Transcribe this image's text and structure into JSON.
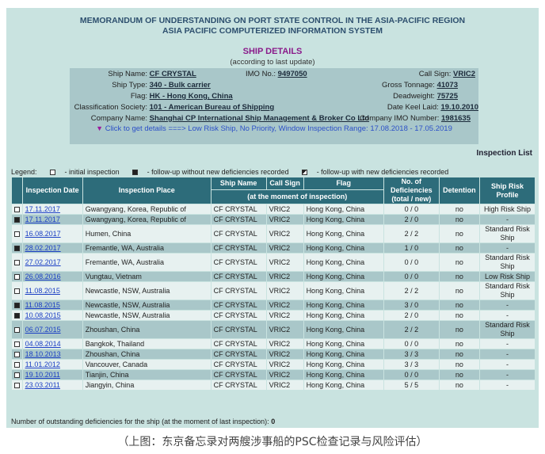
{
  "header": {
    "line1": "MEMORANDUM OF UNDERSTANDING ON PORT STATE CONTROL IN THE ASIA-PACIFIC REGION",
    "line2": "ASIA PACIFIC COMPUTERIZED INFORMATION SYSTEM"
  },
  "ship_details": {
    "title": "SHIP DETAILS",
    "subtitle": "(according to last update)",
    "ship_name_label": "Ship Name:",
    "ship_name": "CF CRYSTAL",
    "imo_label": "IMO No.:",
    "imo": "9497050",
    "call_sign_label": "Call Sign:",
    "call_sign": "VRIC2",
    "ship_type_label": "Ship Type:",
    "ship_type": "340  -  Bulk carrier",
    "gross_tonnage_label": "Gross Tonnage:",
    "gross_tonnage": "41073",
    "flag_label": "Flag:",
    "flag": "HK  -  Hong Kong, China",
    "deadweight_label": "Deadweight:",
    "deadweight": "75725",
    "class_label": "Classification Society:",
    "class": "101  -  American Bureau of Shipping",
    "keel_label": "Date Keel Laid:",
    "keel": "19.10.2010",
    "company_label": "Company Name:",
    "company": "Shanghai CP International Ship Management & Broker Co Ltd",
    "company_imo_label": "Company IMO Number:",
    "company_imo": "1981635",
    "get_details": "Click to get details",
    "arrow_text": "===>",
    "risk_text": "Low Risk Ship, No Priority, Window Inspection Range: 17.08.2018 - 17.05.2019"
  },
  "inspection_list_label": "Inspection List",
  "legend": {
    "label": "Legend:",
    "initial": "- initial inspection",
    "followup_no_new": "- follow-up without new deficiencies recorded",
    "followup_new": "- follow-up with new deficiencies recorded"
  },
  "table": {
    "headers": {
      "date": "Inspection Date",
      "place": "Inspection Place",
      "ship_name": "Ship Name",
      "call_sign": "Call Sign",
      "flag": "Flag",
      "moment": "(at the moment of inspection)",
      "deficiencies": "No. of Deficiencies (total / new)",
      "detention": "Detention",
      "risk": "Ship Risk Profile"
    },
    "rows": [
      {
        "marker": "initial",
        "date": "17.11.2017",
        "place": "Gwangyang, Korea, Republic of",
        "ship": "CF CRYSTAL",
        "call": "VRIC2",
        "flag": "Hong Kong, China",
        "def": "0 / 0",
        "det": "no",
        "risk": "High Risk Ship"
      },
      {
        "marker": "followup",
        "date": "17.11.2017",
        "place": "Gwangyang, Korea, Republic of",
        "ship": "CF CRYSTAL",
        "call": "VRIC2",
        "flag": "Hong Kong, China",
        "def": "2 / 0",
        "det": "no",
        "risk": "-"
      },
      {
        "marker": "initial",
        "date": "16.08.2017",
        "place": "Humen, China",
        "ship": "CF CRYSTAL",
        "call": "VRIC2",
        "flag": "Hong Kong, China",
        "def": "2 / 2",
        "det": "no",
        "risk": "Standard Risk Ship"
      },
      {
        "marker": "followup",
        "date": "28.02.2017",
        "place": "Fremantle, WA, Australia",
        "ship": "CF CRYSTAL",
        "call": "VRIC2",
        "flag": "Hong Kong, China",
        "def": "1 / 0",
        "det": "no",
        "risk": "-"
      },
      {
        "marker": "initial",
        "date": "27.02.2017",
        "place": "Fremantle, WA, Australia",
        "ship": "CF CRYSTAL",
        "call": "VRIC2",
        "flag": "Hong Kong, China",
        "def": "0 / 0",
        "det": "no",
        "risk": "Standard Risk Ship"
      },
      {
        "marker": "initial",
        "date": "26.08.2016",
        "place": "Vungtau, Vietnam",
        "ship": "CF CRYSTAL",
        "call": "VRIC2",
        "flag": "Hong Kong, China",
        "def": "0 / 0",
        "det": "no",
        "risk": "Low Risk Ship"
      },
      {
        "marker": "initial",
        "date": "11.08.2015",
        "place": "Newcastle, NSW, Australia",
        "ship": "CF CRYSTAL",
        "call": "VRIC2",
        "flag": "Hong Kong, China",
        "def": "2 / 2",
        "det": "no",
        "risk": "Standard Risk Ship"
      },
      {
        "marker": "followup",
        "date": "11.08.2015",
        "place": "Newcastle, NSW, Australia",
        "ship": "CF CRYSTAL",
        "call": "VRIC2",
        "flag": "Hong Kong, China",
        "def": "3 / 0",
        "det": "no",
        "risk": "-"
      },
      {
        "marker": "followup",
        "date": "10.08.2015",
        "place": "Newcastle, NSW, Australia",
        "ship": "CF CRYSTAL",
        "call": "VRIC2",
        "flag": "Hong Kong, China",
        "def": "2 / 0",
        "det": "no",
        "risk": "-"
      },
      {
        "marker": "initial",
        "date": "06.07.2015",
        "place": "Zhoushan, China",
        "ship": "CF CRYSTAL",
        "call": "VRIC2",
        "flag": "Hong Kong, China",
        "def": "2 / 2",
        "det": "no",
        "risk": "Standard Risk Ship"
      },
      {
        "marker": "initial",
        "date": "04.08.2014",
        "place": "Bangkok, Thailand",
        "ship": "CF CRYSTAL",
        "call": "VRIC2",
        "flag": "Hong Kong, China",
        "def": "0 / 0",
        "det": "no",
        "risk": "-"
      },
      {
        "marker": "initial",
        "date": "18.10.2013",
        "place": "Zhoushan, China",
        "ship": "CF CRYSTAL",
        "call": "VRIC2",
        "flag": "Hong Kong, China",
        "def": "3 / 3",
        "det": "no",
        "risk": "-"
      },
      {
        "marker": "initial",
        "date": "11.01.2012",
        "place": "Vancouver, Canada",
        "ship": "CF CRYSTAL",
        "call": "VRIC2",
        "flag": "Hong Kong, China",
        "def": "3 / 3",
        "det": "no",
        "risk": "-"
      },
      {
        "marker": "initial",
        "date": "19.10.2011",
        "place": "Tianjin, China",
        "ship": "CF CRYSTAL",
        "call": "VRIC2",
        "flag": "Hong Kong, China",
        "def": "0 / 0",
        "det": "no",
        "risk": "-"
      },
      {
        "marker": "initial",
        "date": "23.03.2011",
        "place": "Jiangyin, China",
        "ship": "CF CRYSTAL",
        "call": "VRIC2",
        "flag": "Hong Kong, China",
        "def": "5 / 5",
        "det": "no",
        "risk": "-"
      }
    ]
  },
  "footer": {
    "text": "Number of outstanding deficiencies for the ship (at the moment of last inspection):",
    "value": "0"
  },
  "caption": "（上图：东京备忘录对两艘涉事船的PSC检查记录与风险评估）"
}
